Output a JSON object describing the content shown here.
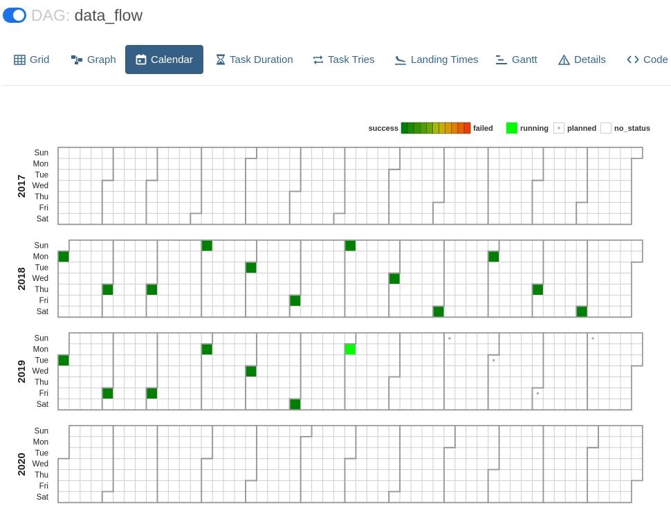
{
  "dag": {
    "prefix": "DAG:",
    "name": "data_flow"
  },
  "tabs": [
    {
      "label": "Grid",
      "icon": "grid-icon"
    },
    {
      "label": "Graph",
      "icon": "graph-icon"
    },
    {
      "label": "Calendar",
      "icon": "calendar-icon",
      "active": true
    },
    {
      "label": "Task Duration",
      "icon": "hourglass-icon"
    },
    {
      "label": "Task Tries",
      "icon": "retry-icon"
    },
    {
      "label": "Landing Times",
      "icon": "landing-icon"
    },
    {
      "label": "Gantt",
      "icon": "gantt-icon"
    },
    {
      "label": "Details",
      "icon": "details-icon"
    },
    {
      "label": "Code",
      "icon": "code-icon"
    }
  ],
  "legend": {
    "success_label": "success",
    "failed_label": "failed",
    "running_label": "running",
    "planned_label": "planned",
    "no_status_label": "no_status",
    "gradient": [
      "#008000",
      "#1a8a00",
      "#349400",
      "#4f9e00",
      "#69a800",
      "#a8b800",
      "#c8b000",
      "#d89a00",
      "#e27f00",
      "#e95f00",
      "#f03c00"
    ]
  },
  "colors": {
    "success": "#008000",
    "running": "#00ff00",
    "planned": "#aaaaaa",
    "cell_border": "#d2d2d2",
    "month_border": "#999999",
    "active_tab": "#365f86",
    "tab_text": "#36688f"
  },
  "weekdays": [
    "Sun",
    "Mon",
    "Tue",
    "Wed",
    "Thu",
    "Fri",
    "Sat"
  ],
  "years": [
    2017,
    2018,
    2019,
    2020
  ],
  "runs": [
    {
      "date": "2018-01-01",
      "state": "success"
    },
    {
      "date": "2018-02-01",
      "state": "success"
    },
    {
      "date": "2018-03-01",
      "state": "success"
    },
    {
      "date": "2018-04-01",
      "state": "success"
    },
    {
      "date": "2018-05-01",
      "state": "success"
    },
    {
      "date": "2018-06-01",
      "state": "success"
    },
    {
      "date": "2018-07-01",
      "state": "success"
    },
    {
      "date": "2018-08-01",
      "state": "success"
    },
    {
      "date": "2018-09-01",
      "state": "success"
    },
    {
      "date": "2018-10-01",
      "state": "success"
    },
    {
      "date": "2018-11-01",
      "state": "success"
    },
    {
      "date": "2018-12-01",
      "state": "success"
    },
    {
      "date": "2019-01-01",
      "state": "success"
    },
    {
      "date": "2019-02-01",
      "state": "success"
    },
    {
      "date": "2019-03-01",
      "state": "success"
    },
    {
      "date": "2019-04-01",
      "state": "success"
    },
    {
      "date": "2019-05-01",
      "state": "success"
    },
    {
      "date": "2019-06-01",
      "state": "success"
    },
    {
      "date": "2019-07-01",
      "state": "running"
    },
    {
      "date": "2019-09-01",
      "state": "planned"
    },
    {
      "date": "2019-10-01",
      "state": "planned"
    },
    {
      "date": "2019-11-01",
      "state": "planned"
    },
    {
      "date": "2019-12-01",
      "state": "planned"
    }
  ]
}
